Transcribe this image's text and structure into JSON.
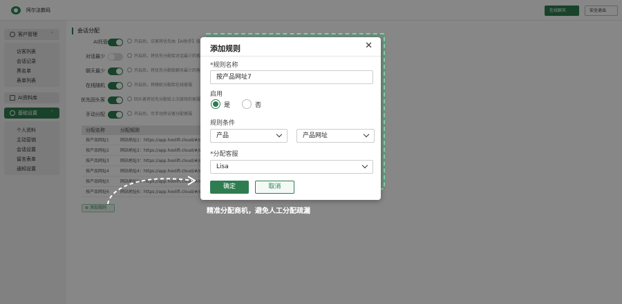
{
  "header": {
    "app_name": "阿尔法数码",
    "online_chat": "在线聊天",
    "exit": "安全退出"
  },
  "sidebar": {
    "customer_mgmt": "客户管理",
    "customer_items": [
      "访客列表",
      "会话记录",
      "黑名单",
      "表单列表"
    ],
    "ai_library": "AI资料库",
    "basic_settings": "基础设置",
    "basic_items": [
      "个人资料",
      "主动营销",
      "会话设置",
      "留言表单",
      "通知设置"
    ]
  },
  "main": {
    "title": "会话分配",
    "settings": [
      {
        "label": "AI托管",
        "on": true,
        "hint": "开启后，访客将优先由【AI助手】接待"
      },
      {
        "label": "对话最少",
        "on": false,
        "hint": "开启后，将优先分配给对话最少的客服"
      },
      {
        "label": "聊天最少",
        "on": true,
        "hint": "开启后，将优先分配给聊天最少的客服"
      },
      {
        "label": "在线随机",
        "on": true,
        "hint": "开启后，将随机分配给在线客服"
      },
      {
        "label": "优先回头客",
        "on": true,
        "hint": "回头客将优先分配给上次接待的客服"
      },
      {
        "label": "手动分配",
        "on": true,
        "hint": "开启后，可手动将访客分配客服"
      }
    ],
    "table": {
      "headers": [
        "分配名称",
        "分配规则"
      ],
      "rows": [
        [
          "按产品网址1",
          "网站地址1：https://app.hoolifi.cloud/#/syste"
        ],
        [
          "按产品网址2",
          "网站地址2：https://app.hoolifi.cloud/#/syste"
        ],
        [
          "按产品网址3",
          "网站地址3：https://app.hoolifi.cloud/#/syste"
        ],
        [
          "按产品网址4",
          "网站地址4：https://app.hoolifi.cloud/#/syste"
        ],
        [
          "按产品网址5",
          "网站地址5：https://app.hoolifi.cloud/#/syste"
        ],
        [
          "按产品网址6",
          "网站地址6：https://app.hoolifi.cloud/#/syste"
        ]
      ]
    },
    "add_rule": "添加规则"
  },
  "modal": {
    "title": "添加规则",
    "name_label": "*规则名称",
    "name_value": "按产品网址7",
    "enable_label": "启用",
    "yes": "是",
    "no": "否",
    "enabled": true,
    "condition_label": "规则条件",
    "condition_field": "产品",
    "condition_value": "产品网址",
    "agent_label": "*分配客服",
    "agent_value": "Lisa",
    "confirm": "确定",
    "cancel": "取消"
  },
  "caption": "精准分配商机，避免人工分配疏漏",
  "colors": {
    "accent": "#2e7d50",
    "highlight": "#7fd3a8"
  }
}
